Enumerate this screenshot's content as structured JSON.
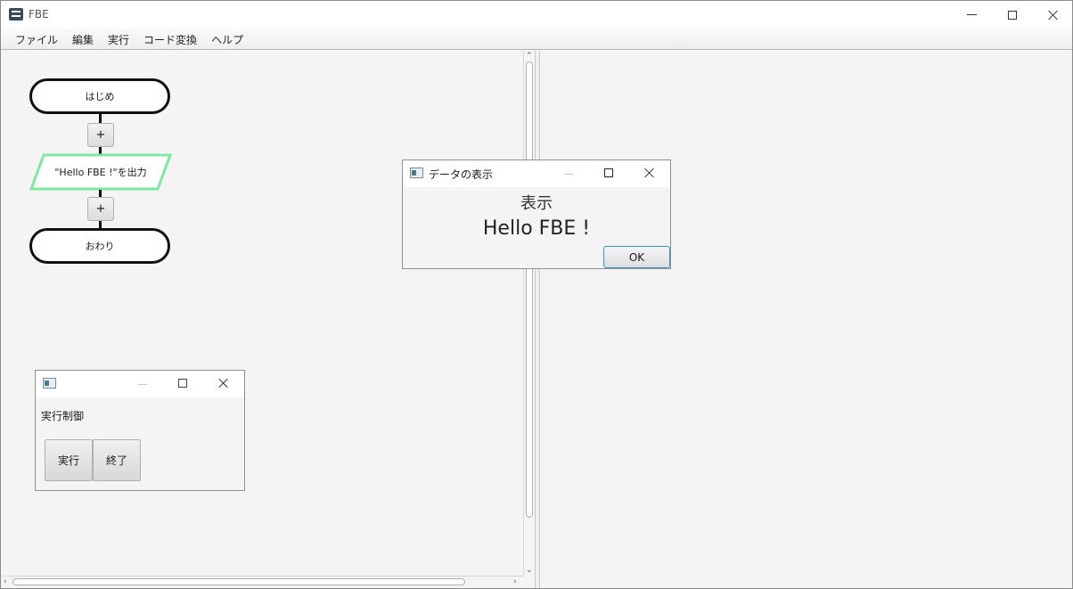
{
  "window": {
    "title": "FBE"
  },
  "menu": {
    "items": [
      "ファイル",
      "編集",
      "実行",
      "コード変換",
      "ヘルプ"
    ]
  },
  "flowchart": {
    "start_label": "はじめ",
    "io_label": "\"Hello FBE !\"を出力",
    "end_label": "おわり",
    "add_label": "+",
    "io_border_color": "#7de8a0"
  },
  "exec_control": {
    "label": "実行制御",
    "run_label": "実行",
    "stop_label": "終了"
  },
  "data_dialog": {
    "title": "データの表示",
    "heading": "表示",
    "value": "Hello FBE !",
    "ok_label": "OK"
  }
}
